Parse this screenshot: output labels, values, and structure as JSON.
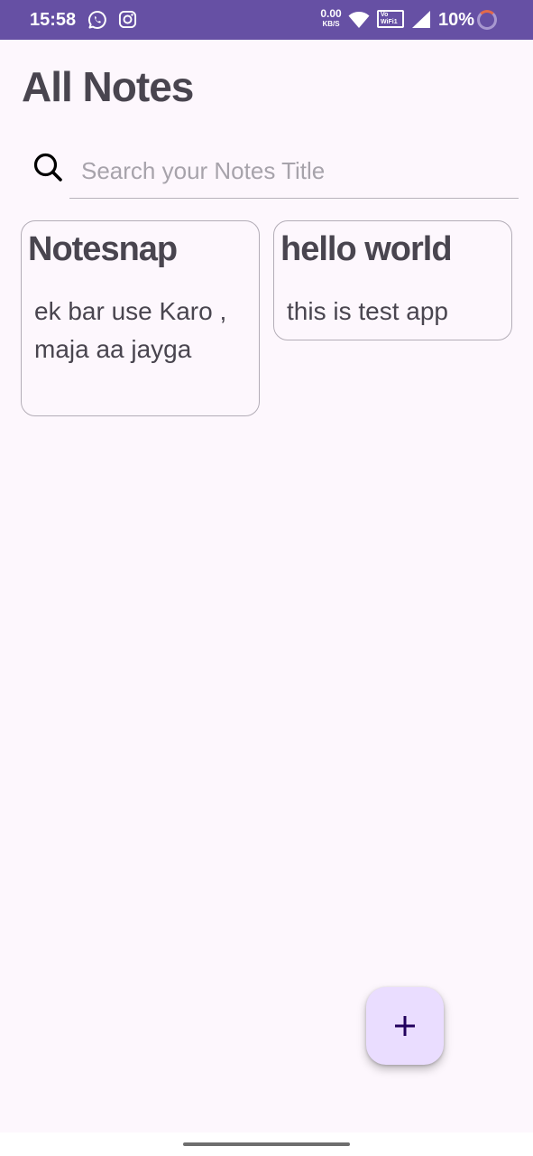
{
  "status_bar": {
    "time": "15:58",
    "net_speed_value": "0.00",
    "net_speed_unit": "KB/S",
    "vowifi_top": "Vo",
    "vowifi_bottom": "WiFi",
    "vowifi_sim": "1",
    "battery": "10%",
    "icons": [
      "whatsapp-icon",
      "instagram-icon",
      "wifi-icon",
      "vowifi-icon",
      "signal-icon",
      "battery-icon"
    ]
  },
  "header": {
    "title": "All Notes"
  },
  "search": {
    "placeholder": "Search your Notes Title",
    "value": "",
    "icon": "search-icon"
  },
  "notes": [
    {
      "title": "Notesnap",
      "body": "ek bar use Karo , maja aa jayga"
    },
    {
      "title": "hello world",
      "body": "this is test app"
    }
  ],
  "fab": {
    "icon": "plus-icon",
    "color": "#eaddff"
  },
  "colors": {
    "status_bar": "#6650a4",
    "background": "#fdf7fd",
    "text": "#49454f",
    "fab_icon": "#21005d"
  }
}
